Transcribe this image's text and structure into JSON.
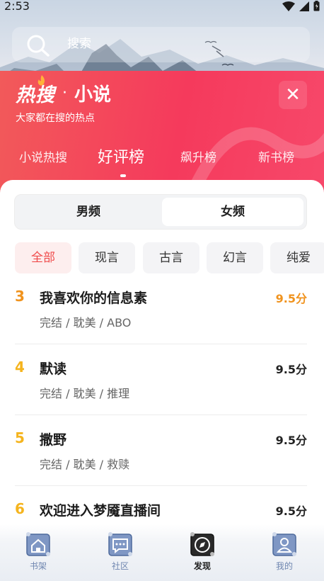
{
  "status_bar": {
    "time": "2:53"
  },
  "search": {
    "placeholder": "搜索"
  },
  "header": {
    "title_left": "热搜",
    "separator": "·",
    "title_right": "小说",
    "subtitle": "大家都在搜的热点",
    "close_symbol": "✕"
  },
  "tabs": [
    {
      "label": "小说热搜",
      "active": false
    },
    {
      "label": "好评榜",
      "active": true
    },
    {
      "label": "飙升榜",
      "active": false
    },
    {
      "label": "新书榜",
      "active": false
    }
  ],
  "gender": [
    {
      "label": "男频",
      "selected": false
    },
    {
      "label": "女频",
      "selected": true
    }
  ],
  "categories": [
    {
      "label": "全部",
      "active": true
    },
    {
      "label": "现言",
      "active": false
    },
    {
      "label": "古言",
      "active": false
    },
    {
      "label": "幻言",
      "active": false
    },
    {
      "label": "纯爱",
      "active": false
    }
  ],
  "books": [
    {
      "rank": "3",
      "title": "我喜欢你的信息素",
      "meta": "完结 / 耽美 / ABO",
      "score": "9.5分",
      "rank_color": "#f0931e",
      "score_color": "#f0931e"
    },
    {
      "rank": "4",
      "title": "默读",
      "meta": "完结 / 耽美 / 推理",
      "score": "9.5分",
      "rank_color": "#f5b41e",
      "score_color": "#222222"
    },
    {
      "rank": "5",
      "title": "撒野",
      "meta": "完结 / 耽美 / 救赎",
      "score": "9.5分",
      "rank_color": "#f5b41e",
      "score_color": "#222222"
    },
    {
      "rank": "6",
      "title": "欢迎进入梦魇直播间",
      "meta": "",
      "score": "9.5分",
      "rank_color": "#f5b41e",
      "score_color": "#222222"
    }
  ],
  "bottom_nav": [
    {
      "label": "书架",
      "icon": "bookshelf-icon",
      "active": false
    },
    {
      "label": "社区",
      "icon": "community-icon",
      "active": false
    },
    {
      "label": "发现",
      "icon": "compass-icon",
      "active": true
    },
    {
      "label": "我的",
      "icon": "profile-icon",
      "active": false
    }
  ],
  "colors": {
    "accent_red": "#f53a5c",
    "rank_top": "#f0931e",
    "rank_other": "#f5b41e",
    "nav_muted": "#6f86b0"
  }
}
